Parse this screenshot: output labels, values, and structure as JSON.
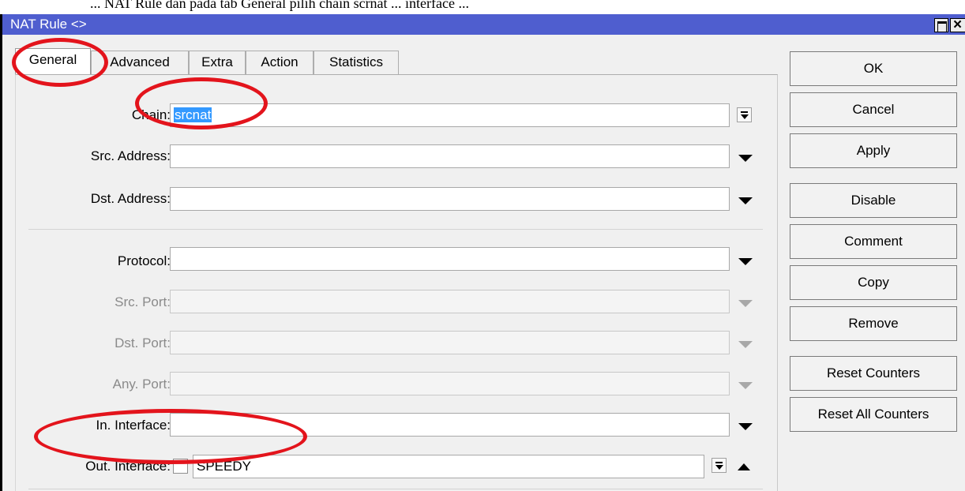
{
  "document_text": "... NAT Rule dan pada tab General  pilih  chain scrnat ... interface ...",
  "window": {
    "title": "NAT Rule <>",
    "maximize_icon": "maximize-icon",
    "close_symbol": "×"
  },
  "tabs": [
    "General",
    "Advanced",
    "Extra",
    "Action",
    "Statistics"
  ],
  "active_tab": "General",
  "fields": {
    "chain": {
      "label": "Chain:",
      "value": "srcnat"
    },
    "src_address": {
      "label": "Src. Address:",
      "value": ""
    },
    "dst_address": {
      "label": "Dst. Address:",
      "value": ""
    },
    "protocol": {
      "label": "Protocol:",
      "value": ""
    },
    "src_port": {
      "label": "Src. Port:",
      "value": ""
    },
    "dst_port": {
      "label": "Dst. Port:",
      "value": ""
    },
    "any_port": {
      "label": "Any. Port:",
      "value": ""
    },
    "in_interface": {
      "label": "In. Interface:",
      "value": ""
    },
    "out_interface": {
      "label": "Out. Interface:",
      "value": "SPEEDY",
      "negate_checked": false
    }
  },
  "buttons": {
    "ok": "OK",
    "cancel": "Cancel",
    "apply": "Apply",
    "disable": "Disable",
    "comment": "Comment",
    "copy": "Copy",
    "remove": "Remove",
    "reset_counters": "Reset Counters",
    "reset_all_counters": "Reset All Counters"
  },
  "colors": {
    "titlebar": "#4f5ecf",
    "annotation_red": "#e3141c",
    "selection": "#3399ff"
  }
}
